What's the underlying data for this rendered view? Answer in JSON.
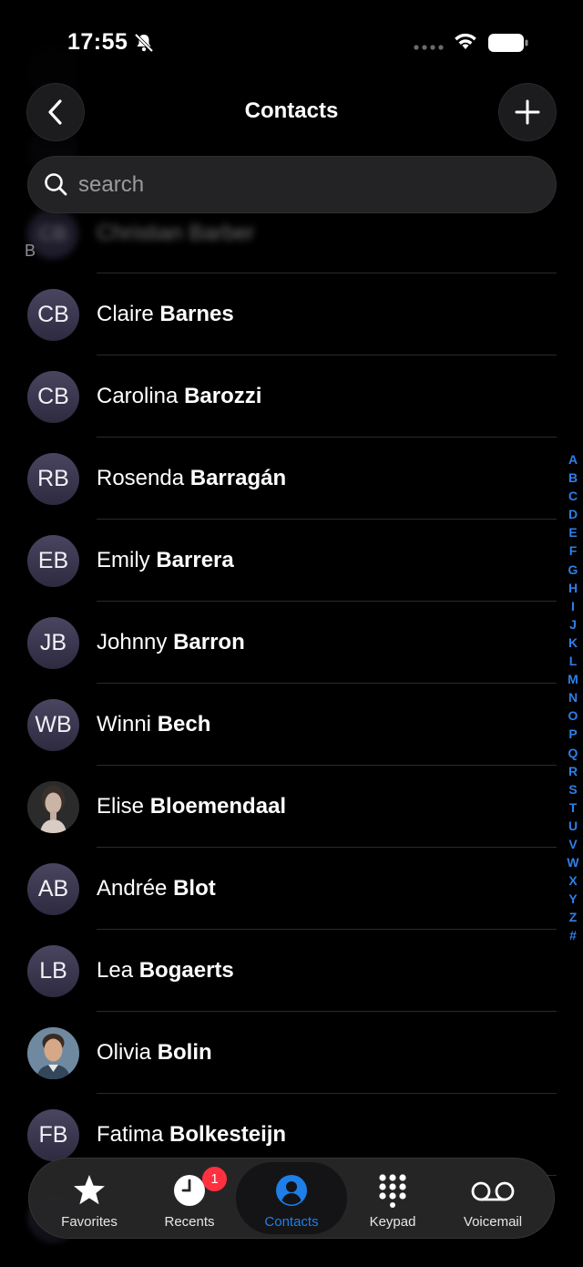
{
  "status_bar": {
    "time": "17:55"
  },
  "header": {
    "title": "Contacts"
  },
  "search": {
    "placeholder": "search"
  },
  "background_rows": [
    {
      "initials": "",
      "name": ""
    },
    {
      "initials": "",
      "name": ""
    },
    {
      "initials": "CB",
      "name": "Christian Barber"
    }
  ],
  "section": "B",
  "contacts": [
    {
      "initials": "CB",
      "first": "Claire",
      "last": "Barnes"
    },
    {
      "initials": "CB",
      "first": "Carolina",
      "last": "Barozzi"
    },
    {
      "initials": "RB",
      "first": "Rosenda",
      "last": "Barragán"
    },
    {
      "initials": "EB",
      "first": "Emily",
      "last": "Barrera"
    },
    {
      "initials": "JB",
      "first": "Johnny",
      "last": "Barron"
    },
    {
      "initials": "WB",
      "first": "Winni",
      "last": "Bech"
    },
    {
      "initials": "",
      "first": "Elise",
      "last": "Bloemendaal",
      "photo": "woman-portrait"
    },
    {
      "initials": "AB",
      "first": "Andrée",
      "last": "Blot"
    },
    {
      "initials": "LB",
      "first": "Lea",
      "last": "Bogaerts"
    },
    {
      "initials": "",
      "first": "Olivia",
      "last": "Bolin",
      "photo": "man-portrait"
    },
    {
      "initials": "FB",
      "first": "Fatima",
      "last": "Bolkesteijn"
    }
  ],
  "index_letters": [
    "A",
    "B",
    "C",
    "D",
    "E",
    "F",
    "G",
    "H",
    "I",
    "J",
    "K",
    "L",
    "M",
    "N",
    "O",
    "P",
    "Q",
    "R",
    "S",
    "T",
    "U",
    "V",
    "W",
    "X",
    "Y",
    "Z",
    "#"
  ],
  "tabbar": {
    "favorites": "Favorites",
    "recents": "Recents",
    "recents_badge": "1",
    "contacts": "Contacts",
    "keypad": "Keypad",
    "voicemail": "Voicemail",
    "active": "contacts"
  },
  "colors": {
    "accent": "#1e7fe8",
    "badge": "#ff3040",
    "background": "#000000"
  }
}
